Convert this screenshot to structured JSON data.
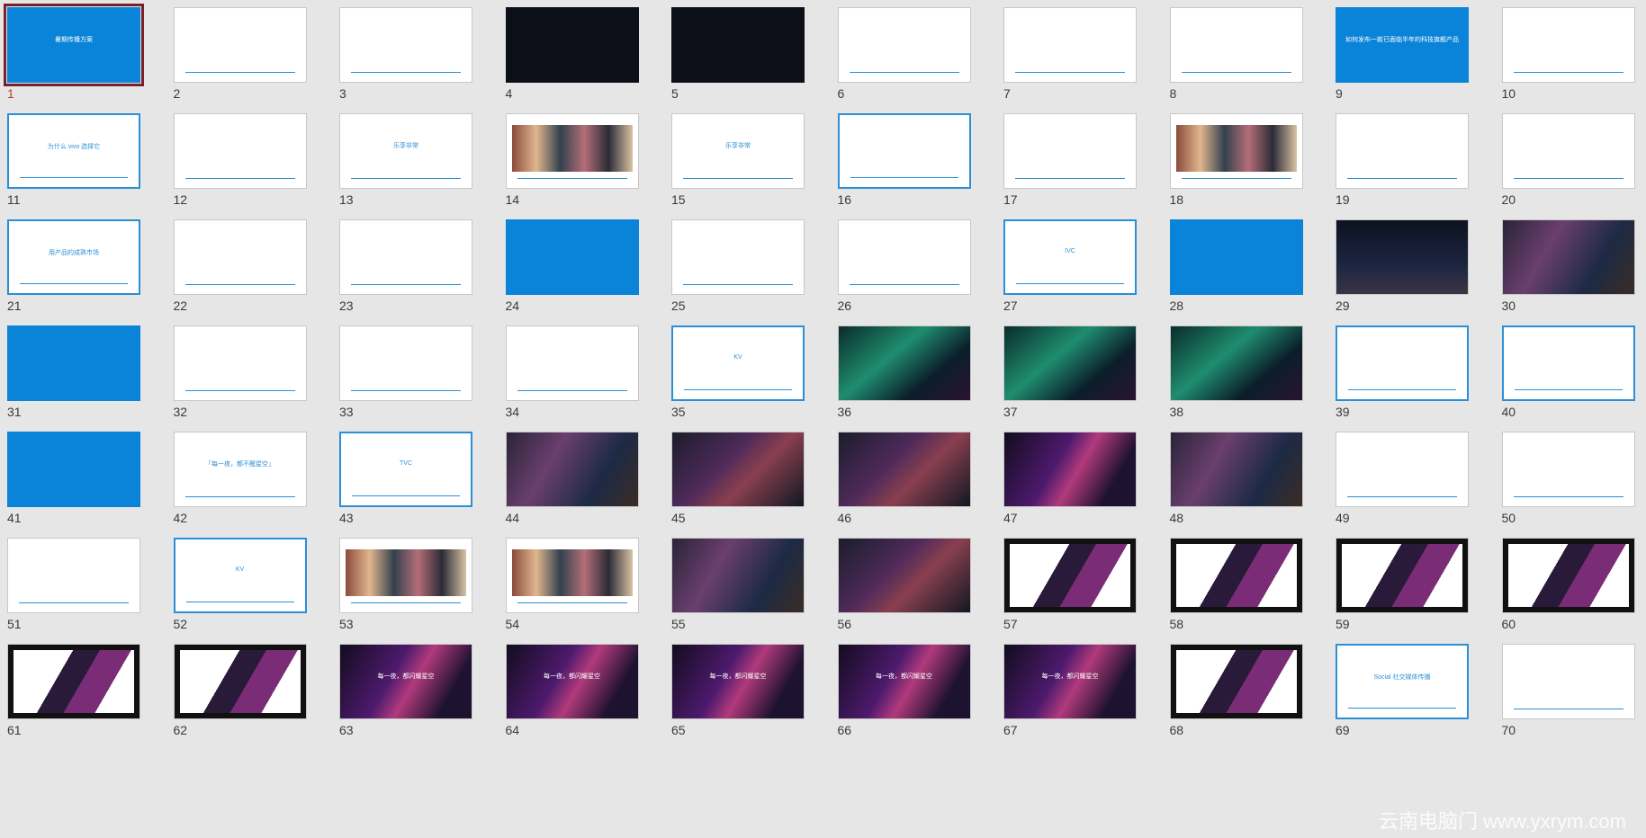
{
  "slides": [
    {
      "n": "1",
      "style": "blue",
      "caption": "暑期传播方案",
      "selected": true
    },
    {
      "n": "2",
      "style": "white",
      "caption": ""
    },
    {
      "n": "3",
      "style": "white",
      "caption": ""
    },
    {
      "n": "4",
      "style": "dark",
      "caption": ""
    },
    {
      "n": "5",
      "style": "dark",
      "caption": ""
    },
    {
      "n": "6",
      "style": "white",
      "caption": ""
    },
    {
      "n": "7",
      "style": "white",
      "caption": ""
    },
    {
      "n": "8",
      "style": "white",
      "caption": ""
    },
    {
      "n": "9",
      "style": "blue",
      "caption": "如何发布一款已面临半年的科技旗舰产品"
    },
    {
      "n": "10",
      "style": "white",
      "caption": ""
    },
    {
      "n": "11",
      "style": "bordered",
      "caption": "为什么 vivo 选择它"
    },
    {
      "n": "12",
      "style": "white",
      "caption": ""
    },
    {
      "n": "13",
      "style": "white",
      "caption": "乐享非常"
    },
    {
      "n": "14",
      "style": "mixed",
      "caption": ""
    },
    {
      "n": "15",
      "style": "white",
      "caption": "乐享非常"
    },
    {
      "n": "16",
      "style": "bordered",
      "caption": ""
    },
    {
      "n": "17",
      "style": "white",
      "caption": ""
    },
    {
      "n": "18",
      "style": "mixed",
      "caption": ""
    },
    {
      "n": "19",
      "style": "white",
      "caption": ""
    },
    {
      "n": "20",
      "style": "white",
      "caption": ""
    },
    {
      "n": "21",
      "style": "bordered",
      "caption": "用产品的成熟市场"
    },
    {
      "n": "22",
      "style": "white",
      "caption": ""
    },
    {
      "n": "23",
      "style": "white",
      "caption": ""
    },
    {
      "n": "24",
      "style": "blue",
      "caption": ""
    },
    {
      "n": "25",
      "style": "white",
      "caption": ""
    },
    {
      "n": "26",
      "style": "white",
      "caption": ""
    },
    {
      "n": "27",
      "style": "bordered",
      "caption": "IVC"
    },
    {
      "n": "28",
      "style": "blue",
      "caption": ""
    },
    {
      "n": "29",
      "style": "night",
      "caption": ""
    },
    {
      "n": "30",
      "style": "photo",
      "caption": ""
    },
    {
      "n": "31",
      "style": "blue",
      "caption": ""
    },
    {
      "n": "32",
      "style": "white",
      "caption": ""
    },
    {
      "n": "33",
      "style": "white",
      "caption": ""
    },
    {
      "n": "34",
      "style": "white",
      "caption": ""
    },
    {
      "n": "35",
      "style": "bordered",
      "caption": "KV"
    },
    {
      "n": "36",
      "style": "aurora",
      "caption": ""
    },
    {
      "n": "37",
      "style": "aurora",
      "caption": ""
    },
    {
      "n": "38",
      "style": "aurora",
      "caption": ""
    },
    {
      "n": "39",
      "style": "bordered",
      "caption": ""
    },
    {
      "n": "40",
      "style": "bordered",
      "caption": ""
    },
    {
      "n": "41",
      "style": "blue",
      "caption": ""
    },
    {
      "n": "42",
      "style": "white",
      "caption": "「每一夜，都不醒星空」"
    },
    {
      "n": "43",
      "style": "bordered",
      "caption": "TVC"
    },
    {
      "n": "44",
      "style": "photo",
      "caption": ""
    },
    {
      "n": "45",
      "style": "photo2",
      "caption": ""
    },
    {
      "n": "46",
      "style": "photo2",
      "caption": ""
    },
    {
      "n": "47",
      "style": "neon",
      "caption": ""
    },
    {
      "n": "48",
      "style": "photo",
      "caption": ""
    },
    {
      "n": "49",
      "style": "white",
      "caption": ""
    },
    {
      "n": "50",
      "style": "white",
      "caption": ""
    },
    {
      "n": "51",
      "style": "white",
      "caption": ""
    },
    {
      "n": "52",
      "style": "bordered",
      "caption": "KV"
    },
    {
      "n": "53",
      "style": "mixed",
      "caption": ""
    },
    {
      "n": "54",
      "style": "mixed",
      "caption": ""
    },
    {
      "n": "55",
      "style": "photo",
      "caption": ""
    },
    {
      "n": "56",
      "style": "photo2",
      "caption": ""
    },
    {
      "n": "57",
      "style": "frame",
      "caption": ""
    },
    {
      "n": "58",
      "style": "frame",
      "caption": ""
    },
    {
      "n": "59",
      "style": "frame",
      "caption": ""
    },
    {
      "n": "60",
      "style": "frame",
      "caption": ""
    },
    {
      "n": "61",
      "style": "frame",
      "caption": ""
    },
    {
      "n": "62",
      "style": "frame",
      "caption": ""
    },
    {
      "n": "63",
      "style": "neon",
      "caption": "每一夜，都闪耀星空"
    },
    {
      "n": "64",
      "style": "neon",
      "caption": "每一夜，都闪耀星空"
    },
    {
      "n": "65",
      "style": "neon",
      "caption": "每一夜，都闪耀星空"
    },
    {
      "n": "66",
      "style": "neon",
      "caption": "每一夜，都闪耀星空"
    },
    {
      "n": "67",
      "style": "neon",
      "caption": "每一夜，都闪耀星空"
    },
    {
      "n": "68",
      "style": "frame",
      "caption": ""
    },
    {
      "n": "69",
      "style": "bordered",
      "caption": "Social 社交媒体传播"
    },
    {
      "n": "70",
      "style": "white",
      "caption": ""
    }
  ],
  "watermark": "云南电脑门 www.yxrym.com"
}
